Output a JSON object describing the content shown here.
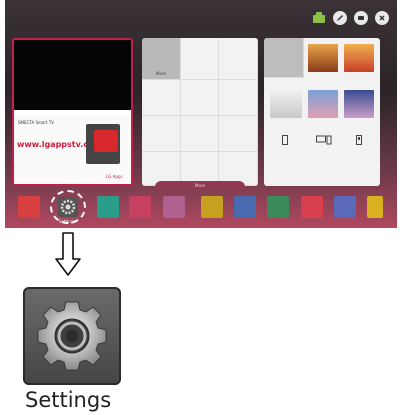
{
  "topbar": {
    "icons": [
      "tv-input-icon",
      "pencil-edit-icon",
      "chat-icon",
      "close-icon"
    ]
  },
  "panels": {
    "live": {
      "promo_brand_text": "SMECTA",
      "promo_brand_text2": "Smart TV",
      "promo_url": "www.lgappstv.com",
      "promo_logo": "LG Apps"
    },
    "premium": {
      "more_label": "More"
    },
    "smartshare": {
      "devices": [
        "phone-icon",
        "computer-icon",
        "usb-icon"
      ]
    }
  },
  "launcher": {
    "more_tab_label": "More",
    "settings_app_label": "Settings"
  },
  "detail": {
    "settings_title": "Settings"
  },
  "colors": {
    "selection_border": "#c41e4a",
    "launcher_band": "#b0485f"
  }
}
